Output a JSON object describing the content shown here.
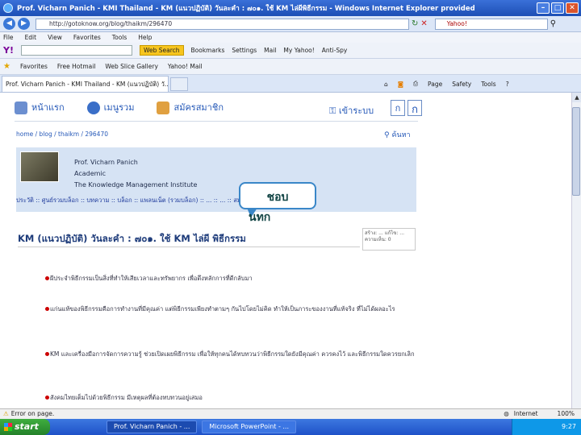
{
  "window": {
    "title": "Prof. Vicharn Panich - KMI Thailand - KM (แนวปฏิบัติ) วันละคำ : ๗๐๑. ใช้ KM ไล่ผีพิธีกรรม - Windows Internet Explorer provided",
    "url": "http://gotoknow.org/blog/thaikm/296470",
    "search_text": "Yahoo!"
  },
  "menu": [
    "File",
    "Edit",
    "View",
    "Favorites",
    "Tools",
    "Help"
  ],
  "yahoo_toolbar": {
    "logo": "Y!",
    "web_search": "Web Search",
    "items": [
      "Bookmarks",
      "Settings",
      "Mail",
      "My Yahoo!",
      "Anti-Spy"
    ]
  },
  "favorites_bar": {
    "favorites": "Favorites",
    "items": [
      "Free Hotmail",
      "Web Slice Gallery",
      "Yahoo! Mail"
    ]
  },
  "tab": {
    "title": "Prof. Vicharn Panich - KMI Thailand - KM (แนวปฏิบัติ) วั..."
  },
  "command_bar": {
    "page": "Page",
    "safety": "Safety",
    "tools": "Tools"
  },
  "site_nav": {
    "home": "หน้าแรก",
    "members": "เมนูรวม",
    "join": "สมัครสมาชิก",
    "login": "เข้าระบบ"
  },
  "breadcrumb": "home / blog / thaikm / 296470",
  "search_link": "ค้นหา",
  "profile": {
    "name": "Prof. Vicharn Panich",
    "role": "Academic",
    "org": "The Knowledge Management Institute",
    "links": "ประวัติ :: ศูนย์รวมบล็อก :: บทความ :: บล็อก :: แพลนเน็ต (รวมบล็อก) :: ... :: ... :: สมุดเยี่ยม"
  },
  "bubble": {
    "line1": "ชอบ",
    "line2": "นทก"
  },
  "post": {
    "title": "KM (แนวปฏิบัติ) วันละคำ : ๗๐๑. ใช้ KM ไล่ผี พิธีกรรม",
    "stats": "สร้าง: ... แก้ไข: ... ความเห็น: 0"
  },
  "paragraphs": [
    "ผีประจำพิธีกรรมเป็นสิ่งที่ทำให้เสียเวลาและทรัพยากร เพื่อดึงหลักการที่ดีกลับมา",
    "แก่นแท้ของพิธีกรรมคือการทำงานที่มีคุณค่า แต่พิธีกรรมเพียงทำตามๆ กันไปโดยไม่คิด ทำให้เป็นภาระของงานที่แท้จริง ที่ไม่ได้ผลอะไร",
    "KM และเครื่องมือการจัดการความรู้ ช่วยเปิดเผยพิธีกรรม เพื่อให้ทุกคนได้ทบทวนว่าพิธีกรรมใดยังมีคุณค่า ควรคงไว้ และพิธีกรรมใดควรยกเลิก",
    "สังคมไทยเต็มไปด้วยพิธีกรรม มีเหตุผลที่ต้องทบทวนอยู่เสมอ"
  ],
  "status": {
    "left": "Error on page.",
    "zone": "Internet",
    "zoom": "100%"
  },
  "taskbar": {
    "start": "start",
    "items": [
      "Prof. Vicharn Panich - ...",
      "Microsoft PowerPoint - ..."
    ],
    "clock": "9:27"
  }
}
